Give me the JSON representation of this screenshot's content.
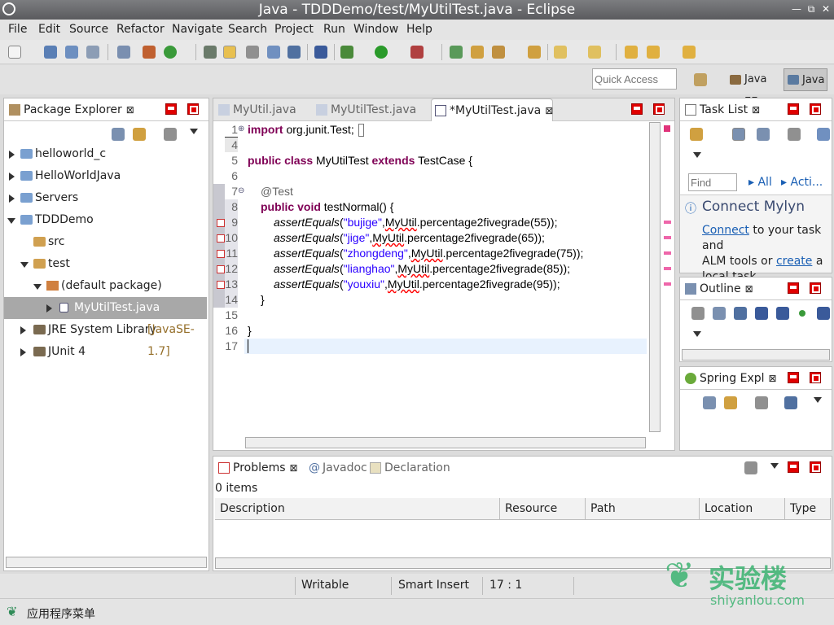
{
  "window": {
    "title": "Java - TDDDemo/test/MyUtilTest.java - Eclipse",
    "minimize_icon": "—",
    "restore_icon": "⧉",
    "close_icon": "✕"
  },
  "menu": [
    "File",
    "Edit",
    "Source",
    "Refactor",
    "Navigate",
    "Search",
    "Project",
    "Run",
    "Window",
    "Help"
  ],
  "quick_access": {
    "placeholder": "Quick Access"
  },
  "perspectives": [
    "Java EE",
    "Java"
  ],
  "package_explorer": {
    "title": "Package Explorer",
    "items": [
      {
        "label": "helloworld_c"
      },
      {
        "label": "HelloWorldJava"
      },
      {
        "label": "Servers"
      },
      {
        "label": "TDDDemo"
      },
      {
        "label": "src"
      },
      {
        "label": "test"
      },
      {
        "label": "(default package)"
      },
      {
        "label": "MyUtilTest.java"
      },
      {
        "label": "JRE System Library",
        "suffix": "[JavaSE-1.7]"
      },
      {
        "label": "JUnit 4"
      }
    ]
  },
  "editor": {
    "tabs": [
      {
        "label": "MyUtil.java"
      },
      {
        "label": "MyUtilTest.java"
      },
      {
        "label": "*MyUtilTest.java"
      }
    ],
    "line_numbers": [
      "1",
      "4",
      "5",
      "6",
      "7",
      "8",
      "9",
      "10",
      "11",
      "12",
      "13",
      "14",
      "15",
      "16",
      "17"
    ],
    "code": {
      "import_kw": "import",
      "import_rest": " org.junit.Test;",
      "public": "public",
      "class": "class",
      "class_name": " MyUtilTest ",
      "extends": "extends",
      "base": " TestCase {",
      "annotation": "@Test",
      "void_kw": "void",
      "method": " testNormal() {",
      "assert_fn": "assertEquals",
      "asserts": [
        {
          "str": "\"bujige\"",
          "arg": "MyUtil",
          "rest": ".percentage2fivegrade(55));"
        },
        {
          "str": "\"jige\"",
          "arg": "MyUtil",
          "rest": ".percentage2fivegrade(65));"
        },
        {
          "str": "\"zhongdeng\"",
          "arg": "MyUtil",
          "rest": ".percentage2fivegrade(75));"
        },
        {
          "str": "\"lianghao\"",
          "arg": "MyUtil",
          "rest": ".percentage2fivegrade(85));"
        },
        {
          "str": "\"youxiu\"",
          "arg": "MyUtil",
          "rest": ".percentage2fivegrade(95));"
        }
      ],
      "close_method": "}",
      "close_class": "}"
    }
  },
  "task_list": {
    "title": "Task List",
    "find_placeholder": "Find",
    "all": "All",
    "acti": "Acti...",
    "connect_title": "Connect Mylyn",
    "connect_link": "Connect",
    "connect_text1": " to your task and",
    "connect_text2": "ALM tools or ",
    "create_link": "create",
    "connect_text3": " a",
    "connect_text4": "local task."
  },
  "outline": {
    "title": "Outline"
  },
  "spring": {
    "title": "Spring Expl"
  },
  "problems": {
    "tabs": [
      "Problems",
      "Javadoc",
      "Declaration"
    ],
    "count": "0 items",
    "columns": [
      "Description",
      "Resource",
      "Path",
      "Location",
      "Type"
    ]
  },
  "status": {
    "writable": "Writable",
    "insert_mode": "Smart Insert",
    "position": "17 : 1"
  },
  "taskbar": {
    "app_menu": "应用程序菜单"
  },
  "watermark": {
    "cn": "实验楼",
    "url": "shiyanlou.com"
  }
}
